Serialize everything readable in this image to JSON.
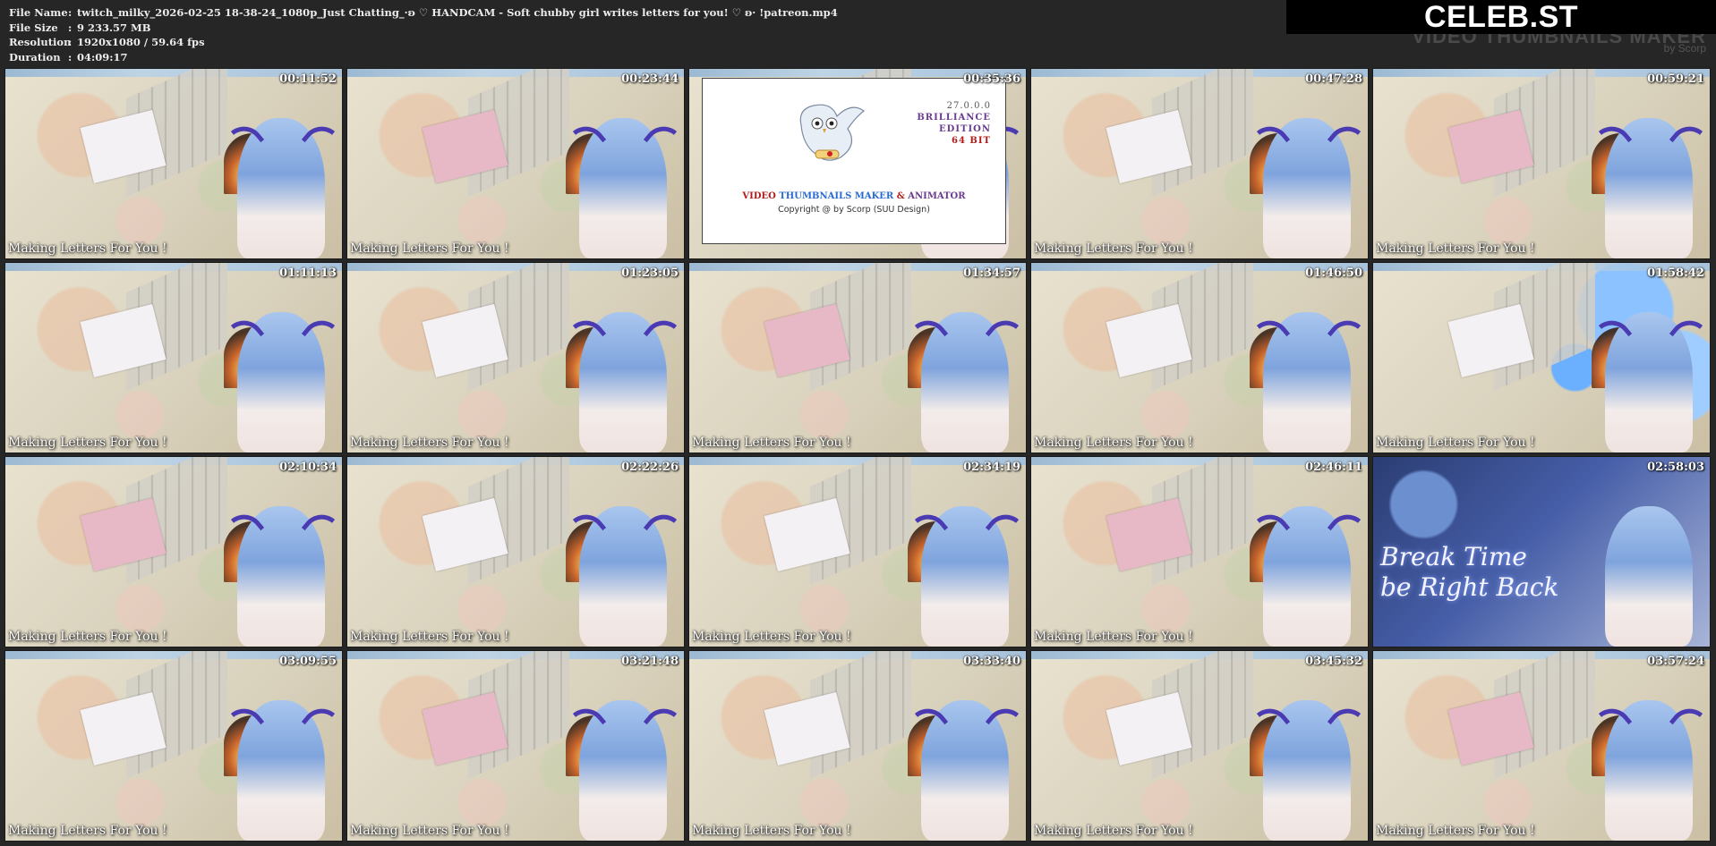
{
  "info": {
    "file_name_label": "File Name",
    "file_name": "twitch_milky_2026-02-25 18-38-24_1080p_Just Chatting_·ʚ ♡ HANDCAM - Soft chubby girl writes letters for you! ♡ ʚ· !patreon.mp4",
    "file_size_label": "File Size",
    "file_size": "9 233.57 MB",
    "resolution_label": "Resolution",
    "resolution": "1920x1080 / 59.64 fps",
    "duration_label": "Duration",
    "duration": "04:09:17",
    "separator": ":"
  },
  "brand": {
    "name": "CELEB.ST",
    "watermark_title": "VIDEO THUMBNAILS MAKER",
    "watermark_by": "by Scorp"
  },
  "logo": {
    "version": "27.0.0.0",
    "edition_line1": "BRILLIANCE",
    "edition_line2": "EDITION",
    "bits": "64 BIT",
    "name_part1": "VIDEO",
    "name_part2": "THUMBNAILS MAKER",
    "name_amp": "&",
    "name_part3": "ANIMATOR",
    "copyright": "Copyright @ by Scorp (SUU Design)"
  },
  "thumbnails": [
    {
      "time": "00:11:52",
      "caption": "Making Letters For You !"
    },
    {
      "time": "00:23:44",
      "caption": "Making Letters For You !"
    },
    {
      "time": "00:35:36",
      "caption": ""
    },
    {
      "time": "00:47:28",
      "caption": "Making Letters For You !"
    },
    {
      "time": "00:59:21",
      "caption": "Making Letters For You !"
    },
    {
      "time": "01:11:13",
      "caption": "Making Letters For You !"
    },
    {
      "time": "01:23:05",
      "caption": "Making Letters For You !"
    },
    {
      "time": "01:34:57",
      "caption": "Making Letters For You !"
    },
    {
      "time": "01:46:50",
      "caption": "Making Letters For You !"
    },
    {
      "time": "01:58:42",
      "caption": "Making Letters For You !"
    },
    {
      "time": "02:10:34",
      "caption": "Making Letters For You !"
    },
    {
      "time": "02:22:26",
      "caption": "Making Letters For You !"
    },
    {
      "time": "02:34:19",
      "caption": "Making Letters For You !"
    },
    {
      "time": "02:46:11",
      "caption": "Making Letters For You !"
    },
    {
      "time": "02:58:03",
      "caption": "",
      "overlay_line1": "Break Time",
      "overlay_line2": "be Right Back"
    },
    {
      "time": "03:09:55",
      "caption": "Making Letters For You !"
    },
    {
      "time": "03:21:48",
      "caption": "Making Letters For You !"
    },
    {
      "time": "03:33:40",
      "caption": "Making Letters For You !"
    },
    {
      "time": "03:45:32",
      "caption": "Making Letters For You !"
    },
    {
      "time": "03:57:24",
      "caption": "Making Letters For You !"
    }
  ]
}
